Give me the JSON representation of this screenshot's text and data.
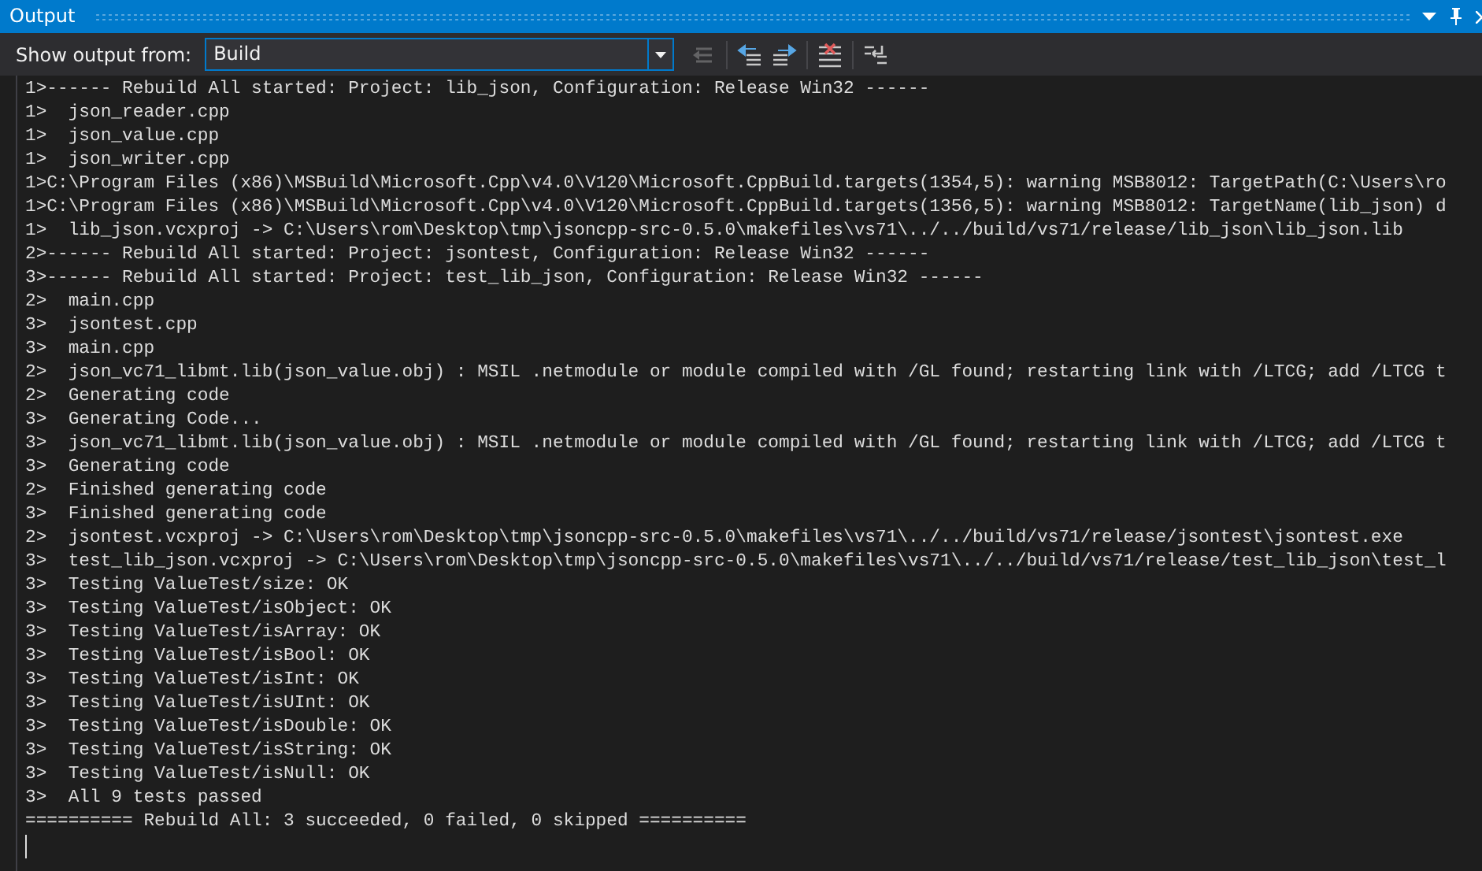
{
  "window": {
    "title": "Output"
  },
  "toolbar": {
    "label": "Show output from:",
    "source": {
      "value": "Build",
      "focused": true
    },
    "buttons": [
      {
        "kind": "goto",
        "disabled": true
      },
      {
        "kind": "prev",
        "disabled": false
      },
      {
        "kind": "next",
        "disabled": false
      },
      {
        "kind": "clear",
        "disabled": false
      },
      {
        "kind": "wrap",
        "disabled": false
      }
    ]
  },
  "lines": [
    "1>------ Rebuild All started: Project: lib_json, Configuration: Release Win32 ------",
    "1>  json_reader.cpp",
    "1>  json_value.cpp",
    "1>  json_writer.cpp",
    "1>C:\\Program Files (x86)\\MSBuild\\Microsoft.Cpp\\v4.0\\V120\\Microsoft.CppBuild.targets(1354,5): warning MSB8012: TargetPath(C:\\Users\\ro",
    "1>C:\\Program Files (x86)\\MSBuild\\Microsoft.Cpp\\v4.0\\V120\\Microsoft.CppBuild.targets(1356,5): warning MSB8012: TargetName(lib_json) d",
    "1>  lib_json.vcxproj -> C:\\Users\\rom\\Desktop\\tmp\\jsoncpp-src-0.5.0\\makefiles\\vs71\\../../build/vs71/release/lib_json\\lib_json.lib",
    "2>------ Rebuild All started: Project: jsontest, Configuration: Release Win32 ------",
    "3>------ Rebuild All started: Project: test_lib_json, Configuration: Release Win32 ------",
    "2>  main.cpp",
    "3>  jsontest.cpp",
    "3>  main.cpp",
    "2>  json_vc71_libmt.lib(json_value.obj) : MSIL .netmodule or module compiled with /GL found; restarting link with /LTCG; add /LTCG t",
    "2>  Generating code",
    "3>  Generating Code...",
    "3>  json_vc71_libmt.lib(json_value.obj) : MSIL .netmodule or module compiled with /GL found; restarting link with /LTCG; add /LTCG t",
    "3>  Generating code",
    "2>  Finished generating code",
    "3>  Finished generating code",
    "2>  jsontest.vcxproj -> C:\\Users\\rom\\Desktop\\tmp\\jsoncpp-src-0.5.0\\makefiles\\vs71\\../../build/vs71/release/jsontest\\jsontest.exe",
    "3>  test_lib_json.vcxproj -> C:\\Users\\rom\\Desktop\\tmp\\jsoncpp-src-0.5.0\\makefiles\\vs71\\../../build/vs71/release/test_lib_json\\test_l",
    "3>  Testing ValueTest/size: OK",
    "3>  Testing ValueTest/isObject: OK",
    "3>  Testing ValueTest/isArray: OK",
    "3>  Testing ValueTest/isBool: OK",
    "3>  Testing ValueTest/isInt: OK",
    "3>  Testing ValueTest/isUInt: OK",
    "3>  Testing ValueTest/isDouble: OK",
    "3>  Testing ValueTest/isString: OK",
    "3>  Testing ValueTest/isNull: OK",
    "3>  All 9 tests passed",
    "========== Rebuild All: 3 succeeded, 0 failed, 0 skipped =========="
  ]
}
